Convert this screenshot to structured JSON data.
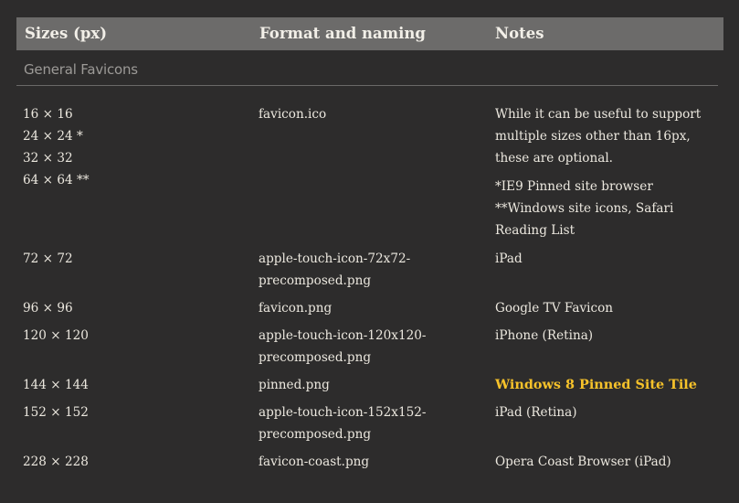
{
  "table": {
    "headers": [
      "Sizes (px)",
      "Format and naming",
      "Notes"
    ],
    "section": "General Favicons",
    "rows": [
      {
        "sizes": [
          "16 × 16",
          "24 × 24 *",
          "32 × 32",
          "64 × 64 **"
        ],
        "format": [
          "favicon.ico"
        ],
        "notes": [
          "While it can be useful to support",
          "multiple sizes other than 16px,",
          "these are optional."
        ],
        "notes_extra": [
          "*IE9 Pinned site browser",
          "**Windows site icons, Safari",
          "Reading List"
        ]
      },
      {
        "sizes": [
          "72 × 72"
        ],
        "format": [
          "apple-touch-icon-72x72-",
          "precomposed.png"
        ],
        "notes": [
          "iPad"
        ]
      },
      {
        "sizes": [
          "96 × 96"
        ],
        "format": [
          "favicon.png"
        ],
        "notes": [
          "Google TV Favicon"
        ]
      },
      {
        "sizes": [
          "120 × 120"
        ],
        "format": [
          "apple-touch-icon-120x120-",
          "precomposed.png"
        ],
        "notes": [
          "iPhone (Retina)"
        ]
      },
      {
        "sizes": [
          "144 × 144"
        ],
        "format": [
          "pinned.png"
        ],
        "notes": [
          "Windows 8 Pinned Site Tile"
        ],
        "highlight": true
      },
      {
        "sizes": [
          "152 × 152"
        ],
        "format": [
          "apple-touch-icon-152x152-",
          "precomposed.png"
        ],
        "notes": [
          "iPad (Retina)"
        ]
      },
      {
        "sizes": [
          "228 × 228"
        ],
        "format": [
          "favicon-coast.png"
        ],
        "notes": [
          "Opera Coast Browser (iPad)"
        ]
      }
    ],
    "highlight_color": "#f6c22a",
    "header_bg": "#6c6b6a"
  }
}
